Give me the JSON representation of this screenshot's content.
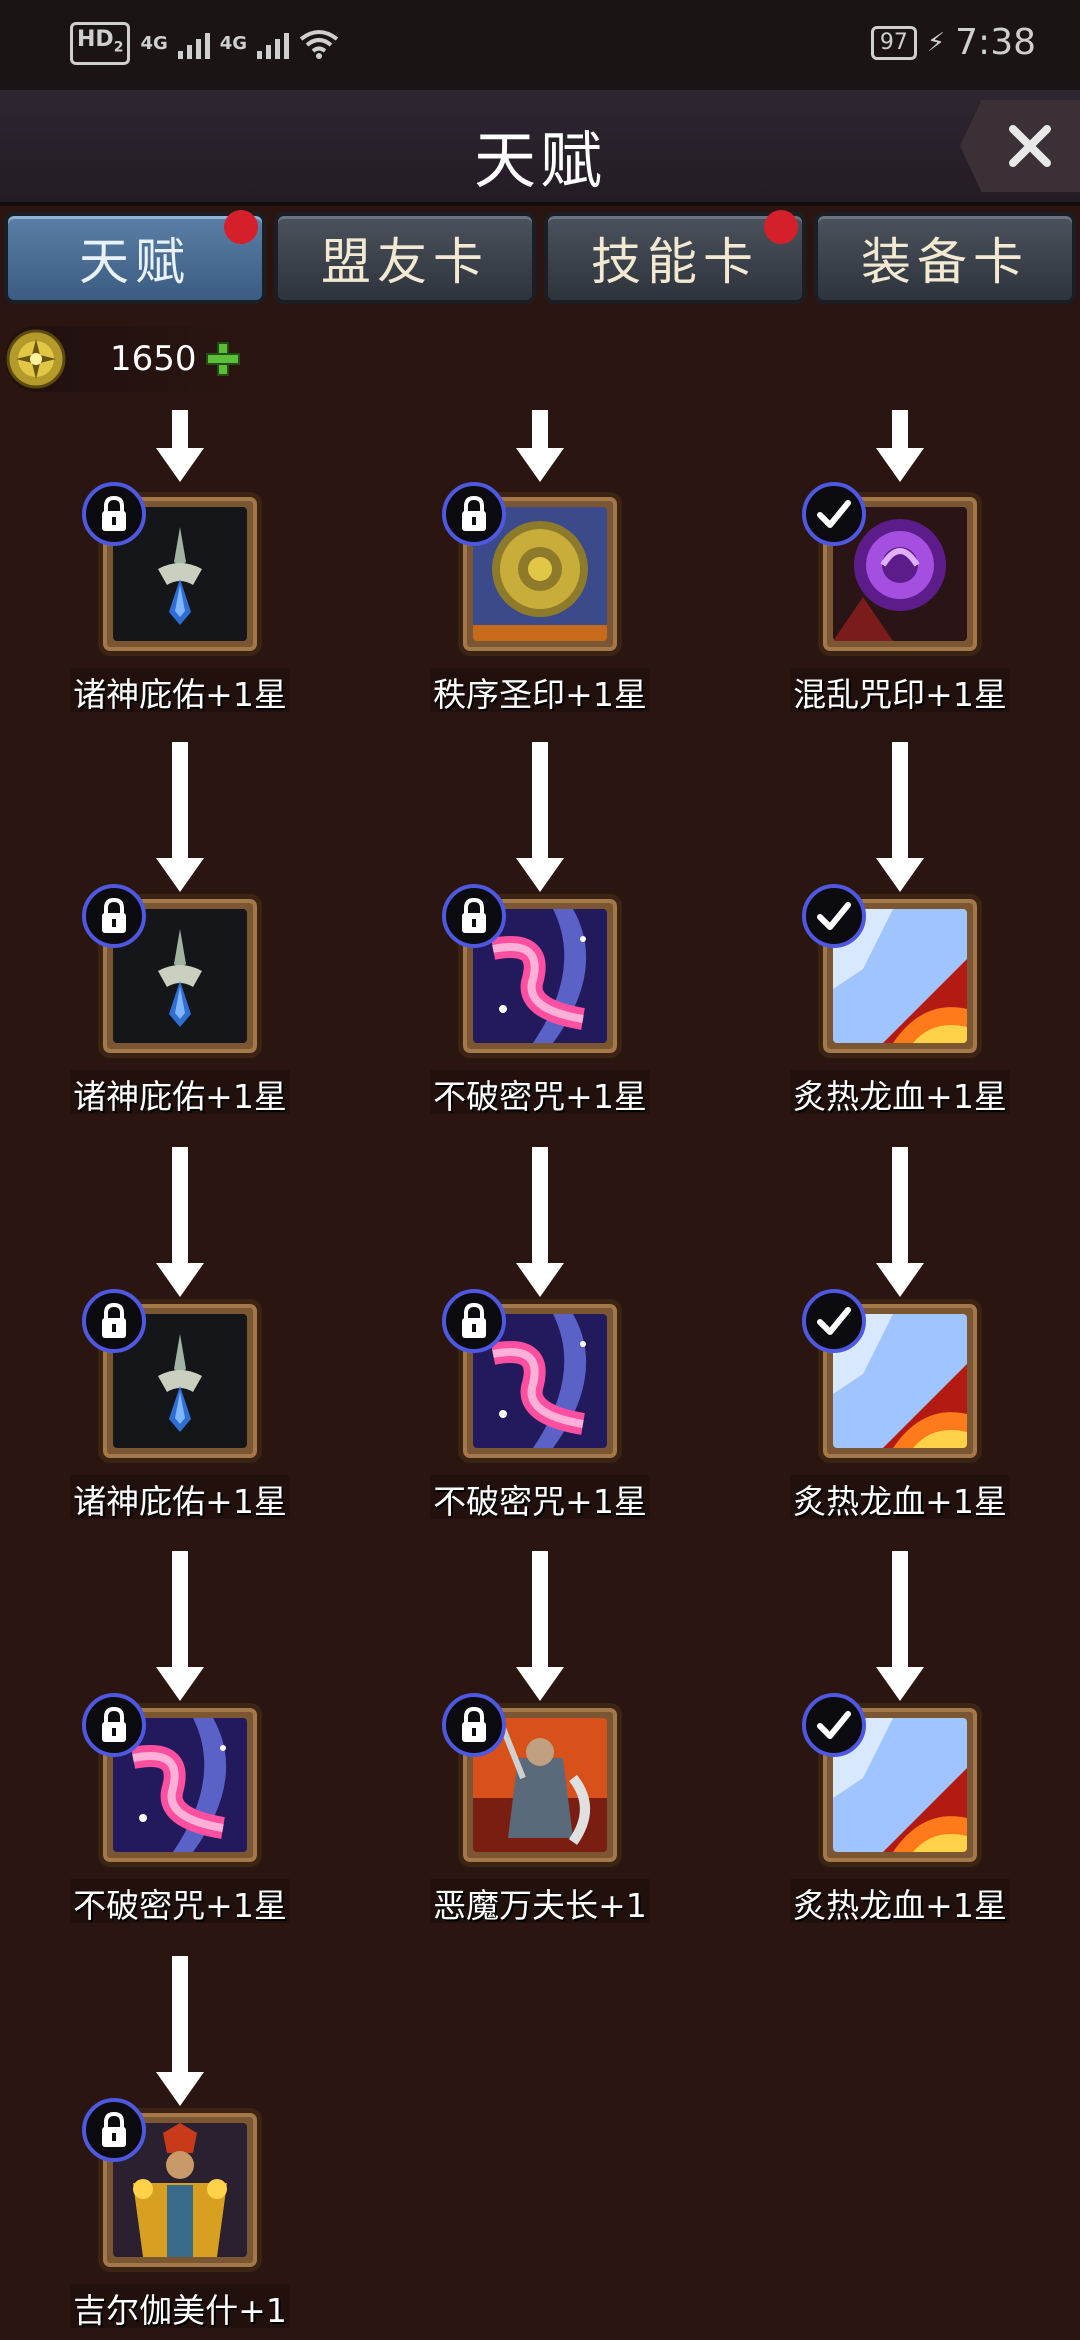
{
  "status_bar": {
    "hd_label": "HD",
    "hd_sub": "2",
    "signal1": "4G",
    "signal2": "4G",
    "battery": "97",
    "time": "7:38"
  },
  "header": {
    "title": "天赋",
    "close_glyph": "✕"
  },
  "tabs": [
    {
      "label": "天赋",
      "active": true,
      "badge": true
    },
    {
      "label": "盟友卡",
      "active": false,
      "badge": false
    },
    {
      "label": "技能卡",
      "active": false,
      "badge": true
    },
    {
      "label": "装备卡",
      "active": false,
      "badge": false
    }
  ],
  "currency": {
    "value": "1650",
    "icon": "talent-coin-icon",
    "add_icon": "plus-icon"
  },
  "talent_tree": {
    "columns": [
      [
        {
          "label": "诸神庇佑+1星",
          "state": "locked",
          "icon": "divine-blessing-icon"
        },
        {
          "label": "诸神庇佑+1星",
          "state": "locked",
          "icon": "divine-blessing-icon"
        },
        {
          "label": "诸神庇佑+1星",
          "state": "locked",
          "icon": "divine-blessing-icon"
        },
        {
          "label": "不破密咒+1星",
          "state": "locked",
          "icon": "unbreakable-curse-icon"
        },
        {
          "label": "吉尔伽美什+1",
          "state": "locked",
          "icon": "gilgamesh-icon"
        }
      ],
      [
        {
          "label": "秩序圣印+1星",
          "state": "locked",
          "icon": "order-seal-icon"
        },
        {
          "label": "不破密咒+1星",
          "state": "locked",
          "icon": "unbreakable-curse-icon"
        },
        {
          "label": "不破密咒+1星",
          "state": "locked",
          "icon": "unbreakable-curse-icon"
        },
        {
          "label": "恶魔万夫长+1",
          "state": "locked",
          "icon": "demon-centurion-icon"
        }
      ],
      [
        {
          "label": "混乱咒印+1星",
          "state": "unlocked",
          "icon": "chaos-seal-icon"
        },
        {
          "label": "炙热龙血+1星",
          "state": "unlocked",
          "icon": "dragon-blood-icon"
        },
        {
          "label": "炙热龙血+1星",
          "state": "unlocked",
          "icon": "dragon-blood-icon"
        },
        {
          "label": "炙热龙血+1星",
          "state": "unlocked",
          "icon": "dragon-blood-icon"
        }
      ]
    ]
  },
  "colors": {
    "background": "#2a1510",
    "tab_active": "#4b6f96",
    "badge_ring": "#4f58e0",
    "red_dot": "#d5202c"
  }
}
